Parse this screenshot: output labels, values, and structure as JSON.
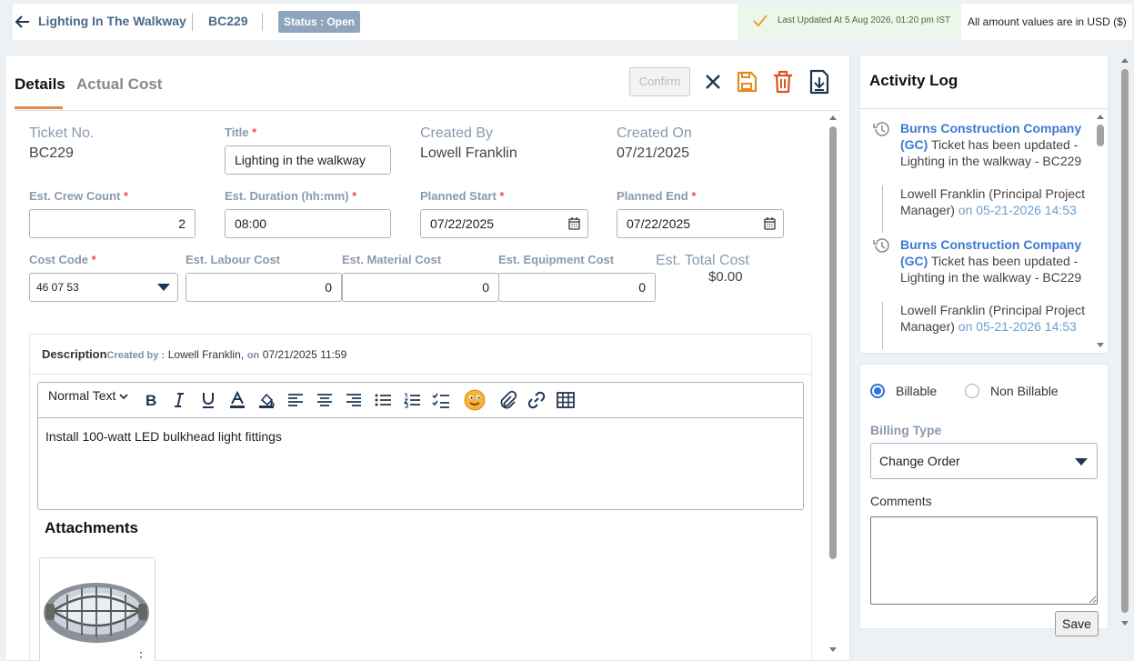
{
  "header": {
    "title": "Lighting In The Walkway",
    "code": "BC229",
    "status": "Status : Open",
    "last_updated": "Last Updated At 5 Aug 2026, 01:20 pm IST",
    "amount_note": "All amount values are in USD ($)"
  },
  "tabs": [
    "Details",
    "Actual Cost"
  ],
  "toolbar": {
    "confirm_label": "Confirm"
  },
  "fields": {
    "ticket_no_label": "Ticket No.",
    "ticket_no": "BC229",
    "title_label": "Title",
    "title_value": "Lighting in the walkway",
    "created_by_label": "Created By",
    "created_by": "Lowell Franklin",
    "created_on_label": "Created On",
    "created_on": "07/21/2025",
    "crew_label": "Est. Crew Count",
    "crew": "2",
    "duration_label": "Est. Duration (hh:mm)",
    "duration": "08:00",
    "planned_start_label": "Planned Start",
    "planned_start": "07/22/2025",
    "planned_end_label": "Planned End",
    "planned_end": "07/22/2025",
    "cost_code_label": "Cost Code",
    "cost_code": "46 07 53",
    "labour_label": "Est. Labour Cost",
    "labour": "0",
    "material_label": "Est. Material Cost",
    "material": "0",
    "equipment_label": "Est. Equipment Cost",
    "equipment": "0",
    "total_label": "Est. Total Cost",
    "total": "$0.00",
    "required_mark": "*"
  },
  "description": {
    "label": "Description",
    "created_by_label": "Created by :",
    "created_by": "Lowell Franklin,",
    "on_label": "on",
    "created_at": "07/21/2025 11:59",
    "format": "Normal Text",
    "text": "Install 100-watt LED bulkhead light fittings"
  },
  "attachments": {
    "heading": "Attachments",
    "menu": "⋮"
  },
  "activity_log": {
    "title": "Activity Log",
    "entries": [
      {
        "company": "Burns Construction Company (GC)",
        "text": " Ticket has been updated - Lighting in the walkway - BC229",
        "who": "Lowell Franklin (Principal Project Manager)",
        "on": " on 05-21-2026 14:53"
      },
      {
        "company": "Burns Construction Company (GC)",
        "text": " Ticket has been updated - Lighting in the walkway - BC229",
        "who": "Lowell Franklin (Principal Project Manager)",
        "on": " on 05-21-2026 14:53"
      }
    ]
  },
  "billing": {
    "billable": "Billable",
    "non_billable": "Non Billable",
    "selected": "Billable",
    "type_label": "Billing Type",
    "type_value": "Change Order",
    "comments_label": "Comments",
    "save_label": "Save"
  },
  "colors": {
    "accent": "#e08a4c",
    "link": "#3b7ad0",
    "status_bg": "#8fa5bd",
    "icon_orange": "#e58a1f",
    "icon_delete": "#d9541e"
  }
}
